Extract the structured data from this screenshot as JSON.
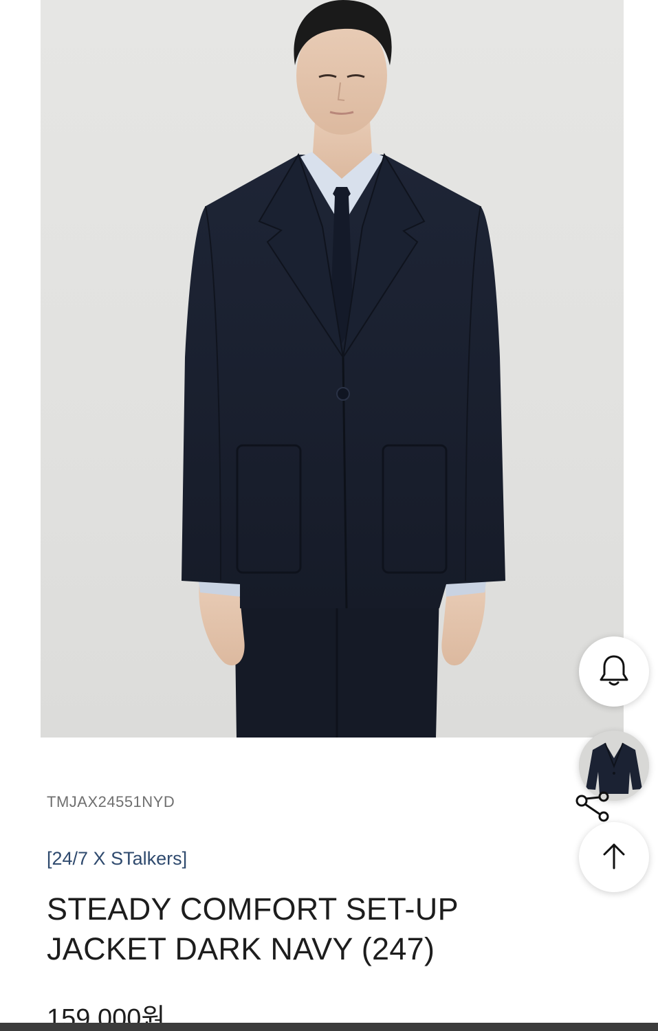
{
  "product": {
    "sku": "TMJAX24551NYD",
    "collaboration": "[24/7 X STalkers]",
    "title": "STEADY COMFORT SET-UP JACKET DARK NAVY (247)",
    "price": "159,000원",
    "image_alt": "Model wearing dark navy set-up jacket with light blue shirt and navy tie"
  },
  "floating_buttons": {
    "alert_icon": "bell-icon",
    "thumbnail_alt": "Dark navy jacket thumbnail",
    "share_icon": "share-icon",
    "top_icon": "arrow-up-icon"
  },
  "colors": {
    "collab_text": "#2f4a6e",
    "sku_text": "#6f6f6f",
    "jacket": "#1b2233",
    "background": "#e3e3e1"
  }
}
